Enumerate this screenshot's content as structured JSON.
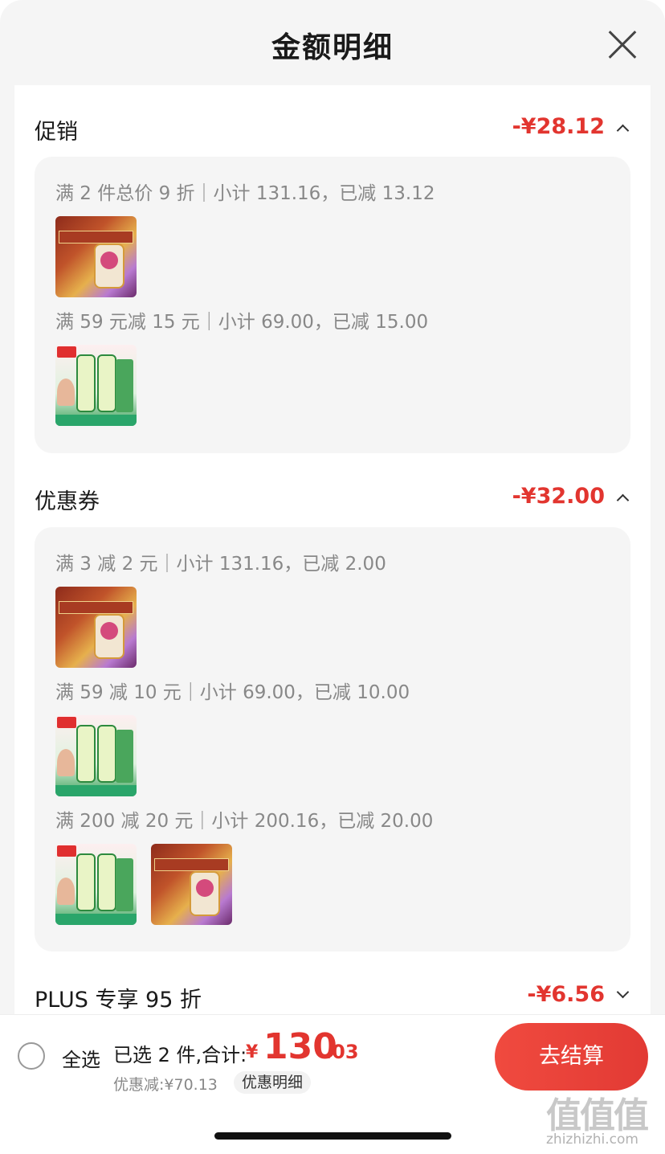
{
  "header": {
    "title": "金额明细"
  },
  "promotion": {
    "title": "促销",
    "amount": "-¥28.12",
    "groups": [
      {
        "rule": "满 2 件总价 9 折｜小计 131.16，已减 13.12",
        "thumbs": [
          "cereal-product"
        ]
      },
      {
        "rule": "满 59 元减 15 元｜小计 69.00，已减 15.00",
        "thumbs": [
          "detergent-product"
        ]
      }
    ]
  },
  "coupon": {
    "title": "优惠券",
    "amount": "-¥32.00",
    "groups": [
      {
        "rule": "满 3 减 2 元｜小计 131.16，已减 2.00",
        "thumbs": [
          "cereal-product"
        ]
      },
      {
        "rule": "满 59 减 10 元｜小计 69.00，已减 10.00",
        "thumbs": [
          "detergent-product"
        ]
      },
      {
        "rule": "满 200 减 20 元｜小计 200.16，已减 20.00",
        "thumbs": [
          "detergent-product",
          "cereal-product"
        ]
      }
    ]
  },
  "plus": {
    "title": "PLUS 专享 95 折",
    "amount": "-¥6.56"
  },
  "footer": {
    "select_all": "全选",
    "summary": "已选 2 件,合计:",
    "currency": "¥",
    "total_int": "130",
    "total_dec": ".03",
    "discount": "优惠减:¥70.13",
    "detail_link": "优惠明细",
    "checkout": "去结算"
  },
  "watermark": {
    "logo": "值值值",
    "site": "zhizhizhi.com"
  },
  "colors": {
    "accent": "#e2352f",
    "checkout": "#f04a3f",
    "sheet_bg": "#f5f5f5"
  }
}
